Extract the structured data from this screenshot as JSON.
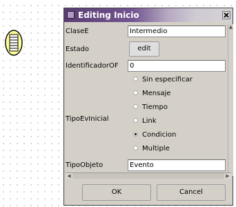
{
  "dialog": {
    "title": "Editing Inicio",
    "ok_label": "OK",
    "cancel_label": "Cancel"
  },
  "fields": {
    "clase": {
      "label": "ClaseE",
      "value": "Intermedio"
    },
    "estado": {
      "label": "Estado",
      "button": "edit"
    },
    "identificador": {
      "label": "IdentificadorOF",
      "value": "0"
    },
    "tipo_ev_inicial": {
      "label": "TipoEvInicial",
      "options": [
        "Sin especificar",
        "Mensaje",
        "Tiempo",
        "Link",
        "Condicion",
        "Multiple"
      ],
      "selected": "Condicion"
    },
    "tipo_objeto": {
      "label": "TipoObjeto",
      "value": "Evento"
    }
  },
  "icons": {
    "title": "window-icon",
    "close": "close-icon",
    "canvas_shape": "start-event-condition-icon"
  },
  "colors": {
    "titlebar": "#5a3e72",
    "dialog_bg": "#d4d0c8",
    "event_fill": "#ffff99"
  }
}
